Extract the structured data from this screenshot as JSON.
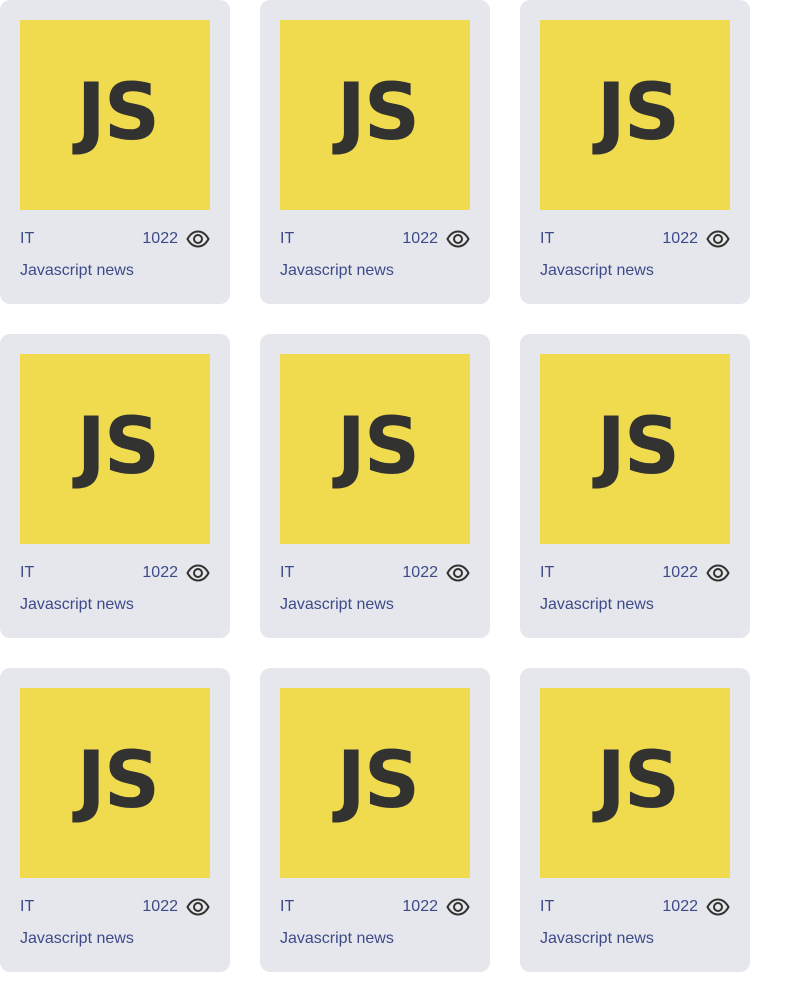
{
  "cards": [
    {
      "logo_text": "JS",
      "category": "IT",
      "views": "1022",
      "title": "Javascript news"
    },
    {
      "logo_text": "JS",
      "category": "IT",
      "views": "1022",
      "title": "Javascript news"
    },
    {
      "logo_text": "JS",
      "category": "IT",
      "views": "1022",
      "title": "Javascript news"
    },
    {
      "logo_text": "JS",
      "category": "IT",
      "views": "1022",
      "title": "Javascript news"
    },
    {
      "logo_text": "JS",
      "category": "IT",
      "views": "1022",
      "title": "Javascript news"
    },
    {
      "logo_text": "JS",
      "category": "IT",
      "views": "1022",
      "title": "Javascript news"
    },
    {
      "logo_text": "JS",
      "category": "IT",
      "views": "1022",
      "title": "Javascript news"
    },
    {
      "logo_text": "JS",
      "category": "IT",
      "views": "1022",
      "title": "Javascript news"
    },
    {
      "logo_text": "JS",
      "category": "IT",
      "views": "1022",
      "title": "Javascript news"
    }
  ],
  "icons": {
    "views_icon": "eye-icon"
  },
  "colors": {
    "card_background": "#e6e7ec",
    "logo_background": "#f0db4f",
    "logo_text": "#323330",
    "text": "#3c4a8a"
  }
}
